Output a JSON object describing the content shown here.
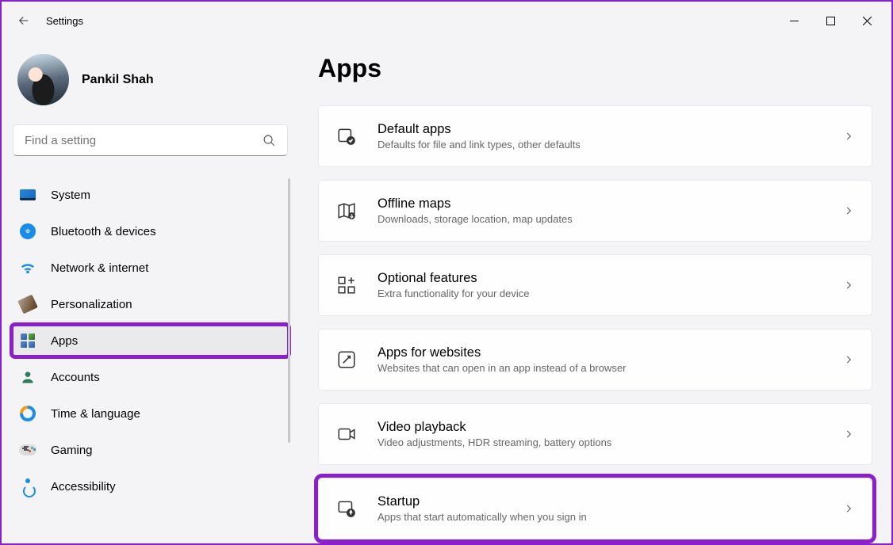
{
  "window": {
    "title": "Settings"
  },
  "user": {
    "name": "Pankil Shah"
  },
  "search": {
    "placeholder": "Find a setting"
  },
  "nav": [
    {
      "id": "system",
      "label": "System"
    },
    {
      "id": "bluetooth",
      "label": "Bluetooth & devices"
    },
    {
      "id": "network",
      "label": "Network & internet"
    },
    {
      "id": "personalization",
      "label": "Personalization"
    },
    {
      "id": "apps",
      "label": "Apps",
      "active": true,
      "highlighted": true
    },
    {
      "id": "accounts",
      "label": "Accounts"
    },
    {
      "id": "time",
      "label": "Time & language"
    },
    {
      "id": "gaming",
      "label": "Gaming"
    },
    {
      "id": "accessibility",
      "label": "Accessibility"
    }
  ],
  "page": {
    "title": "Apps"
  },
  "cards": [
    {
      "id": "default-apps",
      "title": "Default apps",
      "desc": "Defaults for file and link types, other defaults"
    },
    {
      "id": "offline-maps",
      "title": "Offline maps",
      "desc": "Downloads, storage location, map updates"
    },
    {
      "id": "optional-features",
      "title": "Optional features",
      "desc": "Extra functionality for your device"
    },
    {
      "id": "apps-for-websites",
      "title": "Apps for websites",
      "desc": "Websites that can open in an app instead of a browser"
    },
    {
      "id": "video-playback",
      "title": "Video playback",
      "desc": "Video adjustments, HDR streaming, battery options"
    },
    {
      "id": "startup",
      "title": "Startup",
      "desc": "Apps that start automatically when you sign in",
      "highlighted": true
    }
  ]
}
